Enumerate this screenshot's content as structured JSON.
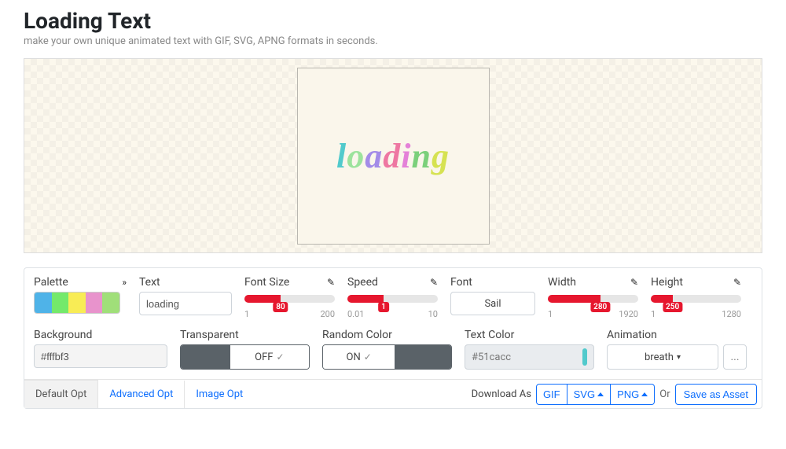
{
  "header": {
    "title": "Loading Text",
    "subtitle": "make your own unique animated text with GIF, SVG, APNG formats in seconds."
  },
  "preview": {
    "letters": [
      "l",
      "o",
      "a",
      "d",
      "i",
      "n",
      "g"
    ]
  },
  "controls": {
    "palette": {
      "label": "Palette"
    },
    "text": {
      "label": "Text",
      "value": "loading"
    },
    "fontSize": {
      "label": "Font Size",
      "min": "1",
      "max": "200",
      "value": "80",
      "fillPct": 40
    },
    "speed": {
      "label": "Speed",
      "min": "0.01",
      "max": "10",
      "value": "1",
      "fillPct": 40
    },
    "font": {
      "label": "Font",
      "value": "Sail"
    },
    "width": {
      "label": "Width",
      "min": "1",
      "max": "1920",
      "value": "280",
      "fillPct": 58
    },
    "height": {
      "label": "Height",
      "min": "1",
      "max": "1280",
      "value": "250",
      "fillPct": 24
    },
    "background": {
      "label": "Background",
      "value": "#fffbf3"
    },
    "transparent": {
      "label": "Transparent",
      "value": "OFF"
    },
    "randomColor": {
      "label": "Random Color",
      "value": "ON"
    },
    "textColor": {
      "label": "Text Color",
      "value": "#51cacc",
      "chip": "#51cacc"
    },
    "animation": {
      "label": "Animation",
      "value": "breath"
    }
  },
  "tabs": {
    "default": "Default Opt",
    "advanced": "Advanced Opt",
    "image": "Image Opt"
  },
  "download": {
    "label": "Download As",
    "gif": "GIF",
    "svg": "SVG",
    "png": "PNG",
    "or": "Or",
    "save": "Save as Asset"
  }
}
